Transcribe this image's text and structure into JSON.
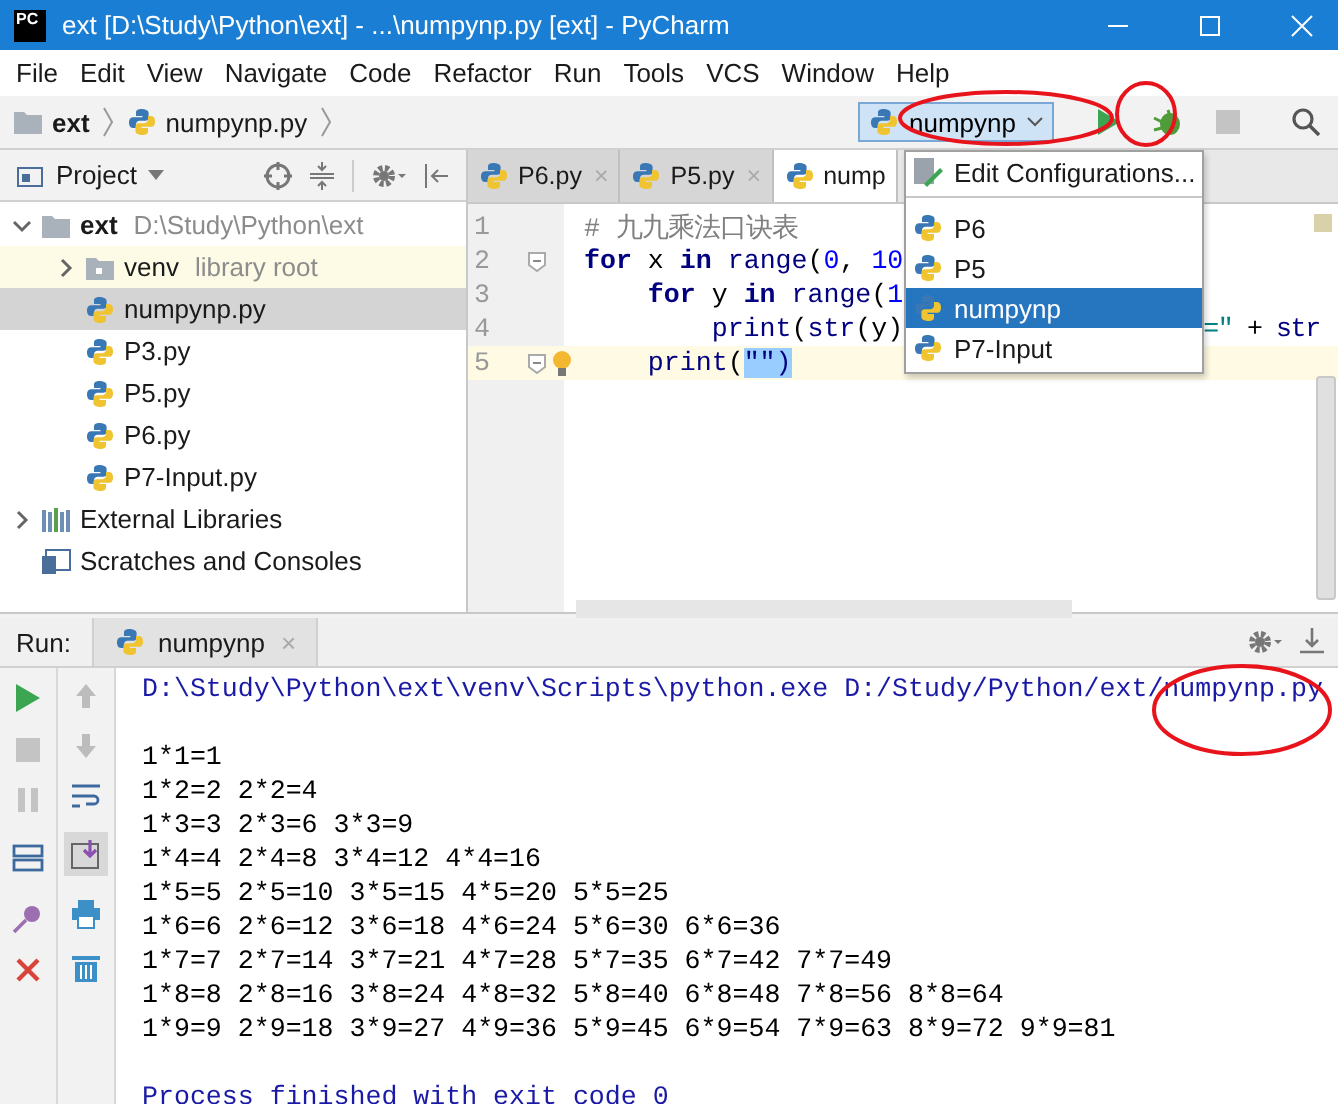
{
  "window": {
    "icon_text": "PC",
    "title": "ext [D:\\Study\\Python\\ext] - ...\\numpynp.py [ext] - PyCharm"
  },
  "menu": [
    "File",
    "Edit",
    "View",
    "Navigate",
    "Code",
    "Refactor",
    "Run",
    "Tools",
    "VCS",
    "Window",
    "Help"
  ],
  "breadcrumb": [
    {
      "label": "ext",
      "kind": "folder"
    },
    {
      "label": "numpynp.py",
      "kind": "python"
    }
  ],
  "run_config": {
    "value": "numpynp"
  },
  "project_panel": {
    "title": "Project",
    "tree": [
      {
        "label": "ext",
        "note": "D:\\Study\\Python\\ext",
        "kind": "folder",
        "expanded": true,
        "selected": false,
        "children": [
          {
            "label": "venv",
            "note": "library root",
            "kind": "library",
            "expanded": false,
            "selected": false
          },
          {
            "label": "numpynp.py",
            "kind": "python",
            "selected": true
          },
          {
            "label": "P3.py",
            "kind": "python",
            "selected": false
          },
          {
            "label": "P5.py",
            "kind": "python",
            "selected": false
          },
          {
            "label": "P6.py",
            "kind": "python",
            "selected": false
          },
          {
            "label": "P7-Input.py",
            "kind": "python",
            "selected": false
          }
        ]
      },
      {
        "label": "External Libraries",
        "kind": "libraries",
        "expanded": false,
        "selected": false
      },
      {
        "label": "Scratches and Consoles",
        "kind": "scratches",
        "selected": false
      }
    ]
  },
  "editor": {
    "tabs": [
      {
        "label": "P6.py",
        "close": "×",
        "selected": false
      },
      {
        "label": "P5.py",
        "close": "×",
        "selected": false
      },
      {
        "label": "nump",
        "selected": true
      }
    ],
    "lines": [
      {
        "number": "1",
        "current": false,
        "fold": false,
        "bulb": false,
        "tokens": [
          {
            "kind": "comment",
            "text": "# 九九乘法口诀表"
          }
        ]
      },
      {
        "number": "2",
        "current": false,
        "fold": true,
        "bulb": false,
        "tokens": [
          {
            "kind": "keyword",
            "text": "for"
          },
          {
            "kind": "plain",
            "text": " x "
          },
          {
            "kind": "keyword",
            "text": "in"
          },
          {
            "kind": "builtin",
            "text": " range"
          },
          {
            "kind": "plain",
            "text": "("
          },
          {
            "kind": "number",
            "text": "0"
          },
          {
            "kind": "plain",
            "text": ", "
          },
          {
            "kind": "number",
            "text": "10"
          }
        ]
      },
      {
        "number": "3",
        "current": false,
        "fold": false,
        "bulb": false,
        "tokens": [
          {
            "kind": "keyword",
            "text": "    for"
          },
          {
            "kind": "plain",
            "text": " y "
          },
          {
            "kind": "keyword",
            "text": "in"
          },
          {
            "kind": "builtin",
            "text": " range"
          },
          {
            "kind": "plain",
            "text": "("
          },
          {
            "kind": "number",
            "text": "1"
          }
        ]
      },
      {
        "number": "4",
        "current": false,
        "fold": false,
        "bulb": false,
        "tokens": [
          {
            "kind": "builtin",
            "text": "        print"
          },
          {
            "kind": "plain",
            "text": "("
          },
          {
            "kind": "builtin",
            "text": "str"
          },
          {
            "kind": "plain",
            "text": "(y)"
          }
        ],
        "tail": [
          {
            "kind": "string",
            "text": "=\""
          },
          {
            "kind": "plain",
            "text": " + "
          },
          {
            "kind": "builtin",
            "text": "str"
          }
        ]
      },
      {
        "number": "5",
        "current": true,
        "fold": true,
        "bulb": true,
        "tokens": [
          {
            "kind": "builtin",
            "text": "    print"
          },
          {
            "kind": "plain",
            "text": "("
          },
          {
            "kind": "match",
            "text": "\"\""
          },
          {
            "kind": "match",
            "text": ")"
          }
        ]
      }
    ]
  },
  "config_popup": {
    "items": [
      {
        "label": "Edit Configurations...",
        "kind": "edit",
        "selected": false
      },
      {
        "label": "P6",
        "kind": "python",
        "selected": false
      },
      {
        "label": "P5",
        "kind": "python",
        "selected": false
      },
      {
        "label": "numpynp",
        "kind": "python",
        "selected": true
      },
      {
        "label": "P7-Input",
        "kind": "python",
        "selected": false
      }
    ]
  },
  "run_panel": {
    "label": "Run:",
    "tab": {
      "label": "numpynp",
      "close": "×"
    },
    "console": [
      {
        "kind": "command",
        "text": "D:\\Study\\Python\\ext\\venv\\Scripts\\python.exe D:/Study/Python/ext/numpynp.py"
      },
      {
        "kind": "blank"
      },
      {
        "kind": "output",
        "text": "1*1=1"
      },
      {
        "kind": "output",
        "text": "1*2=2 2*2=4"
      },
      {
        "kind": "output",
        "text": "1*3=3 2*3=6 3*3=9"
      },
      {
        "kind": "output",
        "text": "1*4=4 2*4=8 3*4=12 4*4=16"
      },
      {
        "kind": "output",
        "text": "1*5=5 2*5=10 3*5=15 4*5=20 5*5=25"
      },
      {
        "kind": "output",
        "text": "1*6=6 2*6=12 3*6=18 4*6=24 5*6=30 6*6=36"
      },
      {
        "kind": "output",
        "text": "1*7=7 2*7=14 3*7=21 4*7=28 5*7=35 6*7=42 7*7=49"
      },
      {
        "kind": "output",
        "text": "1*8=8 2*8=16 3*8=24 4*8=32 5*8=40 6*8=48 7*8=56 8*8=64"
      },
      {
        "kind": "output",
        "text": "1*9=9 2*9=18 3*9=27 4*9=36 5*9=45 6*9=54 7*9=63 8*9=72 9*9=81"
      },
      {
        "kind": "blank"
      },
      {
        "kind": "system",
        "text": "Process finished with exit code 0"
      }
    ]
  }
}
